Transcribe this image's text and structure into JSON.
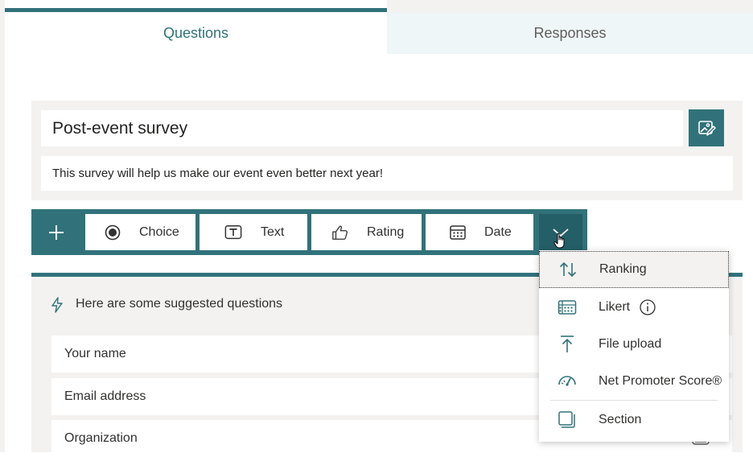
{
  "tabs": {
    "questions": "Questions",
    "responses": "Responses"
  },
  "form": {
    "title": "Post-event survey",
    "description": "This survey will help us make our event even better next year!"
  },
  "toolbar": {
    "choice": "Choice",
    "text": "Text",
    "rating": "Rating",
    "date": "Date"
  },
  "suggestions": {
    "title": "Here are some suggested questions",
    "items": [
      "Your name",
      "Email address",
      "Organization"
    ]
  },
  "dropdown": {
    "items": [
      "Ranking",
      "Likert",
      "File upload",
      "Net Promoter Score®",
      "Section"
    ]
  },
  "icons": {
    "add": "plus-icon",
    "choice": "radio-icon",
    "text": "text-box-icon",
    "rating": "thumbs-up-icon",
    "date": "calendar-icon",
    "more": "chevron-down-icon",
    "title_image": "insert-image-icon",
    "suggestion": "lightning-icon",
    "ranking": "sort-arrows-icon",
    "likert": "grid-icon",
    "likert_info": "info-icon",
    "file_upload": "upload-icon",
    "nps": "gauge-icon",
    "section": "section-icon",
    "cursor": "hand-cursor-icon"
  },
  "colors": {
    "accent": "#31727a",
    "accent_dark": "#245e66",
    "panel": "#f3f2f1"
  }
}
